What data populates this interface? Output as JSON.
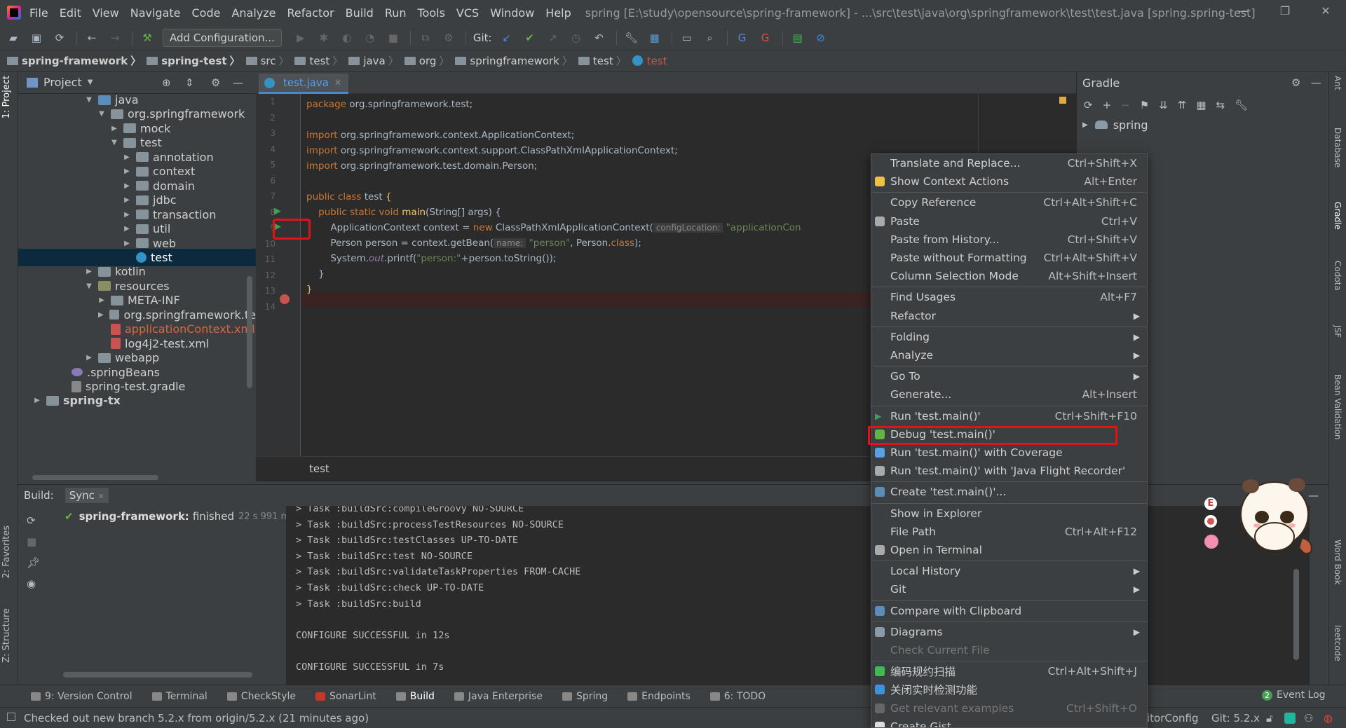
{
  "menu": [
    "File",
    "Edit",
    "View",
    "Navigate",
    "Code",
    "Analyze",
    "Refactor",
    "Build",
    "Run",
    "Tools",
    "VCS",
    "Window",
    "Help"
  ],
  "window_title": "spring [E:\\study\\opensource\\spring-framework] - ...\\src\\test\\java\\org\\springframework\\test\\test.java [spring.spring-test]",
  "toolbar": {
    "add_config": "Add Configuration...",
    "git_label": "Git:"
  },
  "breadcrumb": [
    "spring-framework",
    "spring-test",
    "src",
    "test",
    "java",
    "org",
    "springframework",
    "test",
    "test"
  ],
  "left_strip": {
    "project": "1: Project",
    "favorites": "2: Favorites",
    "structure": "Z: Structure"
  },
  "project": {
    "title": "Project",
    "tree": [
      {
        "label": "java",
        "icon": "src"
      },
      {
        "label": "org.springframework",
        "icon": "folder"
      },
      {
        "label": "mock",
        "icon": "folder"
      },
      {
        "label": "test",
        "icon": "folder"
      },
      {
        "label": "annotation",
        "icon": "folder"
      },
      {
        "label": "context",
        "icon": "folder"
      },
      {
        "label": "domain",
        "icon": "folder"
      },
      {
        "label": "jdbc",
        "icon": "folder"
      },
      {
        "label": "transaction",
        "icon": "folder"
      },
      {
        "label": "util",
        "icon": "folder"
      },
      {
        "label": "web",
        "icon": "folder"
      },
      {
        "label": "test",
        "icon": "class"
      },
      {
        "label": "kotlin",
        "icon": "folder"
      },
      {
        "label": "resources",
        "icon": "res"
      },
      {
        "label": "META-INF",
        "icon": "folder"
      },
      {
        "label": "org.springframework.te",
        "icon": "folder"
      },
      {
        "label": "applicationContext.xml",
        "icon": "xml"
      },
      {
        "label": "log4j2-test.xml",
        "icon": "xml"
      },
      {
        "label": "webapp",
        "icon": "folder"
      },
      {
        "label": ".springBeans",
        "icon": "beans"
      },
      {
        "label": "spring-test.gradle",
        "icon": "file"
      },
      {
        "label": "spring-tx",
        "icon": "folder"
      }
    ]
  },
  "editor": {
    "tab": "test.java",
    "footer": "test",
    "line_numbers": [
      "1",
      "2",
      "3",
      "4",
      "5",
      "6",
      "7",
      "8",
      "9",
      "10",
      "11",
      "12",
      "13",
      "14"
    ],
    "code": {
      "l1_kw": "package",
      "l1_rest": " org.springframework.test;",
      "imp_kw": "import",
      "l3_rest": " org.springframework.context.ApplicationContext;",
      "l4_rest": " org.springframework.context.support.ClassPathXmlApplicationContext;",
      "l5_rest": " org.springframework.test.domain.Person;",
      "l7_kw": "public class",
      "l7_name": " test ",
      "l7_brace": "{",
      "l8_kw": "    public static void",
      "l8_name": " main",
      "l8_rest": "(String[] args) {",
      "l9_a": "        ApplicationContext context = ",
      "l9_new": "new",
      "l9_b": " ClassPathXmlApplicationContext(",
      "l9_hint": "configLocation:",
      "l9_str": " \"applicationCon",
      "l10_a": "        Person person = context.getBean(",
      "l10_hint": "name:",
      "l10_str": " \"person\"",
      "l10_b": ", Person.",
      "l10_kw": "class",
      "l10_c": ");",
      "l11_a": "        System.",
      "l11_out": "out",
      "l11_b": ".printf(",
      "l11_str": "\"person:\"",
      "l11_c": "+person.toString());",
      "l12": "    }",
      "l13": "}"
    }
  },
  "gradle": {
    "title": "Gradle",
    "root": "spring"
  },
  "right_strip": [
    "Ant",
    "Database",
    "Gradle",
    "Codota",
    "JSF",
    "Bean Validation",
    "Word Book",
    "leetcode"
  ],
  "build": {
    "tab_build": "Build:",
    "tab_sync": "Sync",
    "tree_project": "spring-framework:",
    "tree_status": "finished",
    "tree_time": "22 s 991 ms",
    "console": [
      "> Task :buildSrc:compileGroovy NO-SOURCE",
      "> Task :buildSrc:processTestResources NO-SOURCE",
      "> Task :buildSrc:testClasses UP-TO-DATE",
      "> Task :buildSrc:test NO-SOURCE",
      "> Task :buildSrc:validateTaskProperties FROM-CACHE",
      "> Task :buildSrc:check UP-TO-DATE",
      "> Task :buildSrc:build",
      "",
      "CONFIGURE SUCCESSFUL in 12s",
      "",
      "CONFIGURE SUCCESSFUL in 7s"
    ]
  },
  "bottom_tabs": [
    "9: Version Control",
    "Terminal",
    "CheckStyle",
    "SonarLint",
    "Build",
    "Java Enterprise",
    "Spring",
    "Endpoints",
    "6: TODO"
  ],
  "event_log": {
    "count": "2",
    "label": "Event Log"
  },
  "status": {
    "message": "Checked out new branch 5.2.x from origin/5.2.x (21 minutes ago)",
    "editor_config": "itorConfig",
    "git_branch": "Git: 5.2.x"
  },
  "context_menu": [
    {
      "label": "Translate and Replace...",
      "shortcut": "Ctrl+Shift+X"
    },
    {
      "label": "Show Context Actions",
      "shortcut": "Alt+Enter",
      "icon": "bulb"
    },
    {
      "sep": true
    },
    {
      "label": "Copy Reference",
      "shortcut": "Ctrl+Alt+Shift+C"
    },
    {
      "label": "Paste",
      "shortcut": "Ctrl+V",
      "icon": "paste"
    },
    {
      "label": "Paste from History...",
      "shortcut": "Ctrl+Shift+V"
    },
    {
      "label": "Paste without Formatting",
      "shortcut": "Ctrl+Alt+Shift+V"
    },
    {
      "label": "Column Selection Mode",
      "shortcut": "Alt+Shift+Insert"
    },
    {
      "sep": true
    },
    {
      "label": "Find Usages",
      "shortcut": "Alt+F7"
    },
    {
      "label": "Refactor",
      "submenu": true
    },
    {
      "sep": true
    },
    {
      "label": "Folding",
      "submenu": true
    },
    {
      "label": "Analyze",
      "submenu": true
    },
    {
      "sep": true
    },
    {
      "label": "Go To",
      "submenu": true
    },
    {
      "label": "Generate...",
      "shortcut": "Alt+Insert"
    },
    {
      "sep": true
    },
    {
      "label": "Run 'test.main()'",
      "shortcut": "Ctrl+Shift+F10",
      "icon": "run"
    },
    {
      "label": "Debug 'test.main()'",
      "icon": "debug"
    },
    {
      "label": "Run 'test.main()' with Coverage",
      "icon": "coverage"
    },
    {
      "label": "Run 'test.main()' with 'Java Flight Recorder'",
      "icon": "jfr"
    },
    {
      "sep": true
    },
    {
      "label": "Create 'test.main()'...",
      "icon": "create"
    },
    {
      "sep": true
    },
    {
      "label": "Show in Explorer"
    },
    {
      "label": "File Path",
      "shortcut": "Ctrl+Alt+F12"
    },
    {
      "label": "Open in Terminal",
      "icon": "terminal"
    },
    {
      "sep": true
    },
    {
      "label": "Local History",
      "submenu": true
    },
    {
      "label": "Git",
      "submenu": true
    },
    {
      "sep": true
    },
    {
      "label": "Compare with Clipboard",
      "icon": "compare"
    },
    {
      "sep": true
    },
    {
      "label": "Diagrams",
      "submenu": true,
      "icon": "diagram"
    },
    {
      "label": "Check Current File",
      "disabled": true
    },
    {
      "sep": true
    },
    {
      "label": "编码规约扫描",
      "shortcut": "Ctrl+Alt+Shift+J",
      "icon": "scan"
    },
    {
      "label": "关闭实时检测功能",
      "icon": "stop"
    },
    {
      "label": "Get relevant examples",
      "shortcut": "Ctrl+Shift+O",
      "disabled": true,
      "icon": "codota"
    },
    {
      "label": "Create Gist...",
      "icon": "github"
    }
  ],
  "colors": {
    "bg": "#3c3f41",
    "editor_bg": "#2b2b2b",
    "highlight_red": "#e01414",
    "selection": "#0d293e",
    "accent_blue": "#4a88c7"
  }
}
